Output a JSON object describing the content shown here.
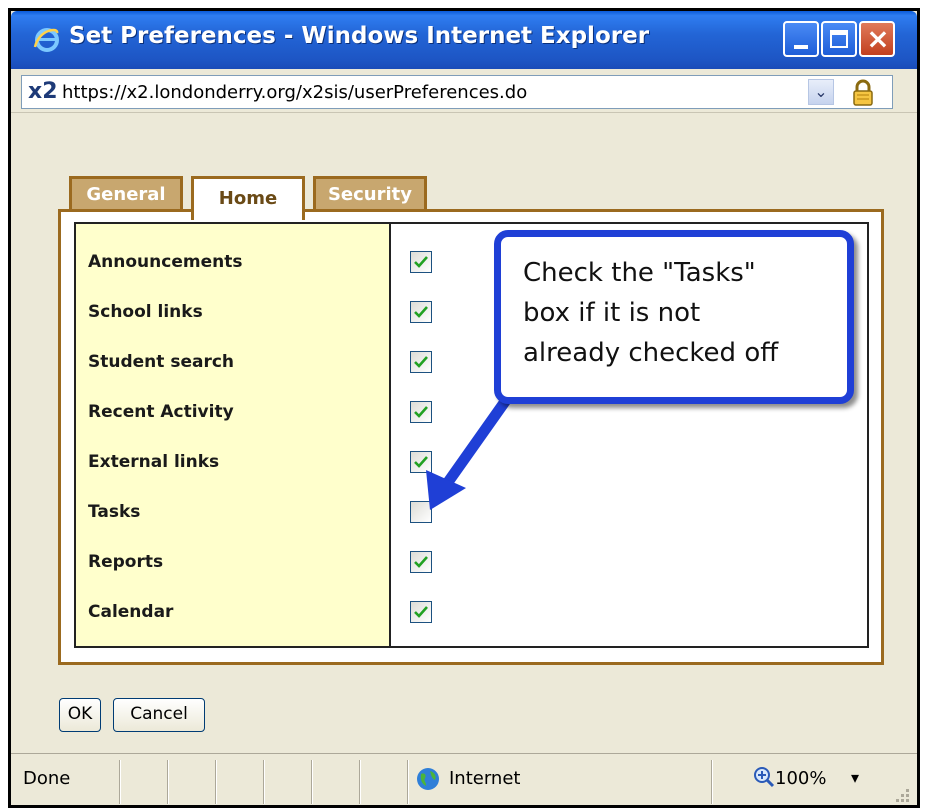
{
  "window": {
    "title": "Set Preferences - Windows Internet Explorer",
    "url": "https://x2.londonderry.org/x2sis/userPreferences.do",
    "address_logo": "x2"
  },
  "tabs": [
    {
      "label": "General",
      "active": false
    },
    {
      "label": "Home",
      "active": true
    },
    {
      "label": "Security",
      "active": false
    }
  ],
  "preferences": [
    {
      "label": "Announcements",
      "checked": true
    },
    {
      "label": "School links",
      "checked": true
    },
    {
      "label": "Student search",
      "checked": true
    },
    {
      "label": "Recent Activity",
      "checked": true
    },
    {
      "label": "External links",
      "checked": true
    },
    {
      "label": "Tasks",
      "checked": false
    },
    {
      "label": "Reports",
      "checked": true
    },
    {
      "label": "Calendar",
      "checked": true
    }
  ],
  "callout": {
    "lines": [
      "Check the \"Tasks\"",
      "box if it is not",
      "already checked off"
    ],
    "border_color": "#1f3fd6"
  },
  "buttons": {
    "ok": "OK",
    "cancel": "Cancel"
  },
  "status": {
    "text": "Done",
    "zone": "Internet",
    "zoom": "100%"
  },
  "colors": {
    "tab_border": "#9b6a1f",
    "label_background": "#ffffcc",
    "titlebar": "#2365d6"
  }
}
